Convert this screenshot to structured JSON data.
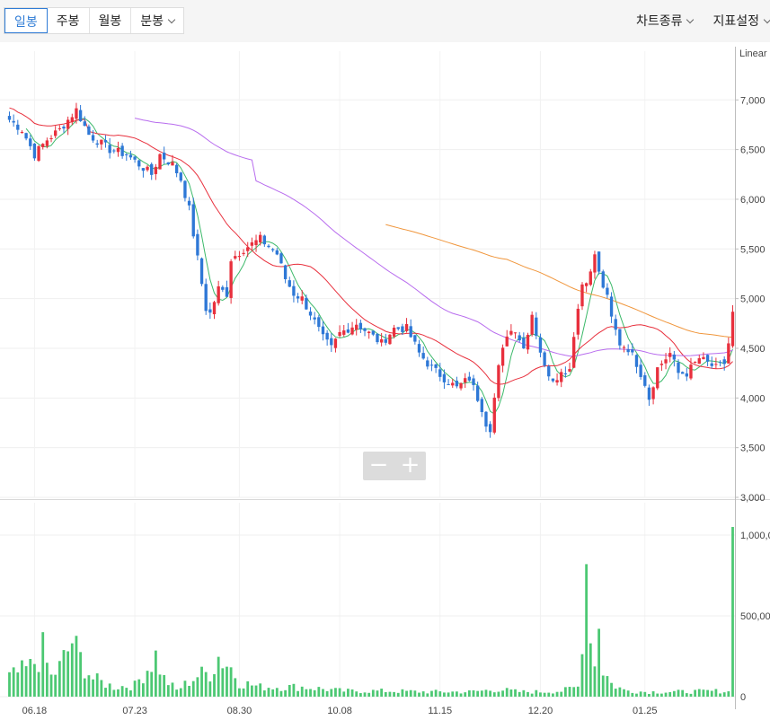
{
  "toolbar": {
    "period_tabs": [
      {
        "label": "일봉",
        "active": true
      },
      {
        "label": "주봉",
        "active": false
      },
      {
        "label": "월봉",
        "active": false
      },
      {
        "label": "분봉",
        "active": false,
        "dropdown": true
      }
    ],
    "chart_type_label": "차트종류",
    "indicator_label": "지표설정"
  },
  "zoom": {
    "minus_label": "−",
    "plus_label": "+"
  },
  "colors": {
    "up": "#e8303d",
    "down": "#2e78d6",
    "ma5": "#3cb96a",
    "ma20": "#e8303d",
    "ma60": "#b86cee",
    "ma120": "#f0963c",
    "volume": "#4cc873"
  },
  "chart_data": {
    "type": "candlestick",
    "scale_label": "Linear",
    "price_ticks": [
      "7,000",
      "6,500",
      "6,000",
      "5,500",
      "5,000",
      "4,500",
      "4,000",
      "3,500",
      "3,000"
    ],
    "price_ylim": [
      3000,
      7400
    ],
    "volume_ticks": [
      "1,000,00",
      "500,00",
      "0"
    ],
    "volume_ylim": [
      0,
      1200000
    ],
    "x_ticks": [
      {
        "label": "06.18",
        "index": 6
      },
      {
        "label": "07.23",
        "index": 30
      },
      {
        "label": "08.30",
        "index": 55
      },
      {
        "label": "10.08",
        "index": 79
      },
      {
        "label": "11.15",
        "index": 103
      },
      {
        "label": "12.20",
        "index": 127
      },
      {
        "label": "01.25",
        "index": 152
      }
    ],
    "n_bars": 174,
    "anchors": [
      [
        0,
        6800
      ],
      [
        3,
        6700
      ],
      [
        6,
        6450
      ],
      [
        9,
        6600
      ],
      [
        12,
        6700
      ],
      [
        16,
        6900
      ],
      [
        19,
        6650
      ],
      [
        24,
        6500
      ],
      [
        28,
        6450
      ],
      [
        31,
        6350
      ],
      [
        34,
        6250
      ],
      [
        36,
        6450
      ],
      [
        39,
        6350
      ],
      [
        41,
        6200
      ],
      [
        43,
        5900
      ],
      [
        45,
        5400
      ],
      [
        47,
        4900
      ],
      [
        48,
        4850
      ],
      [
        50,
        5100
      ],
      [
        52,
        5050
      ],
      [
        53,
        5400
      ],
      [
        56,
        5500
      ],
      [
        60,
        5600
      ],
      [
        64,
        5450
      ],
      [
        66,
        5200
      ],
      [
        68,
        5050
      ],
      [
        70,
        5000
      ],
      [
        72,
        4850
      ],
      [
        75,
        4600
      ],
      [
        77,
        4500
      ],
      [
        79,
        4650
      ],
      [
        83,
        4750
      ],
      [
        86,
        4650
      ],
      [
        89,
        4550
      ],
      [
        92,
        4700
      ],
      [
        95,
        4700
      ],
      [
        98,
        4450
      ],
      [
        101,
        4300
      ],
      [
        104,
        4200
      ],
      [
        107,
        4100
      ],
      [
        110,
        4200
      ],
      [
        113,
        3900
      ],
      [
        114,
        3750
      ],
      [
        115,
        3700
      ],
      [
        117,
        4300
      ],
      [
        119,
        4650
      ],
      [
        121,
        4700
      ],
      [
        123,
        4500
      ],
      [
        125,
        4850
      ],
      [
        126,
        4650
      ],
      [
        128,
        4300
      ],
      [
        130,
        4200
      ],
      [
        132,
        4250
      ],
      [
        134,
        4300
      ],
      [
        135,
        4650
      ],
      [
        137,
        5150
      ],
      [
        139,
        5250
      ],
      [
        140,
        5450
      ],
      [
        141,
        5250
      ],
      [
        143,
        5000
      ],
      [
        144,
        4800
      ],
      [
        146,
        4550
      ],
      [
        148,
        4500
      ],
      [
        150,
        4350
      ],
      [
        152,
        4150
      ],
      [
        153,
        4000
      ],
      [
        155,
        4300
      ],
      [
        158,
        4450
      ],
      [
        160,
        4250
      ],
      [
        162,
        4250
      ],
      [
        165,
        4400
      ],
      [
        169,
        4300
      ],
      [
        171,
        4350
      ],
      [
        172,
        4550
      ],
      [
        173,
        4850
      ]
    ],
    "volume_anchors": [
      [
        0,
        120000
      ],
      [
        5,
        180000
      ],
      [
        8,
        280000
      ],
      [
        10,
        120000
      ],
      [
        12,
        180000
      ],
      [
        15,
        330000
      ],
      [
        17,
        230000
      ],
      [
        20,
        110000
      ],
      [
        25,
        60000
      ],
      [
        30,
        70000
      ],
      [
        35,
        250000
      ],
      [
        37,
        110000
      ],
      [
        40,
        40000
      ],
      [
        45,
        130000
      ],
      [
        48,
        150000
      ],
      [
        50,
        250000
      ],
      [
        53,
        180000
      ],
      [
        55,
        90000
      ],
      [
        60,
        60000
      ],
      [
        70,
        60000
      ],
      [
        80,
        35000
      ],
      [
        90,
        35000
      ],
      [
        100,
        30000
      ],
      [
        110,
        30000
      ],
      [
        117,
        45000
      ],
      [
        122,
        30000
      ],
      [
        127,
        30000
      ],
      [
        132,
        35000
      ],
      [
        136,
        60000
      ],
      [
        138,
        820000
      ],
      [
        139,
        330000
      ],
      [
        140,
        190000
      ],
      [
        141,
        420000
      ],
      [
        142,
        170000
      ],
      [
        144,
        80000
      ],
      [
        147,
        40000
      ],
      [
        152,
        30000
      ],
      [
        160,
        30000
      ],
      [
        170,
        35000
      ],
      [
        172,
        30000
      ],
      [
        173,
        1050000
      ]
    ],
    "ma_series": [
      {
        "name": "MA5",
        "color": "#3cb96a",
        "period": 5
      },
      {
        "name": "MA20",
        "color": "#e8303d",
        "period": 20
      },
      {
        "name": "MA60",
        "color": "#b86cee",
        "period": 60
      },
      {
        "name": "MA120",
        "color": "#f0963c",
        "period": 120
      }
    ]
  }
}
